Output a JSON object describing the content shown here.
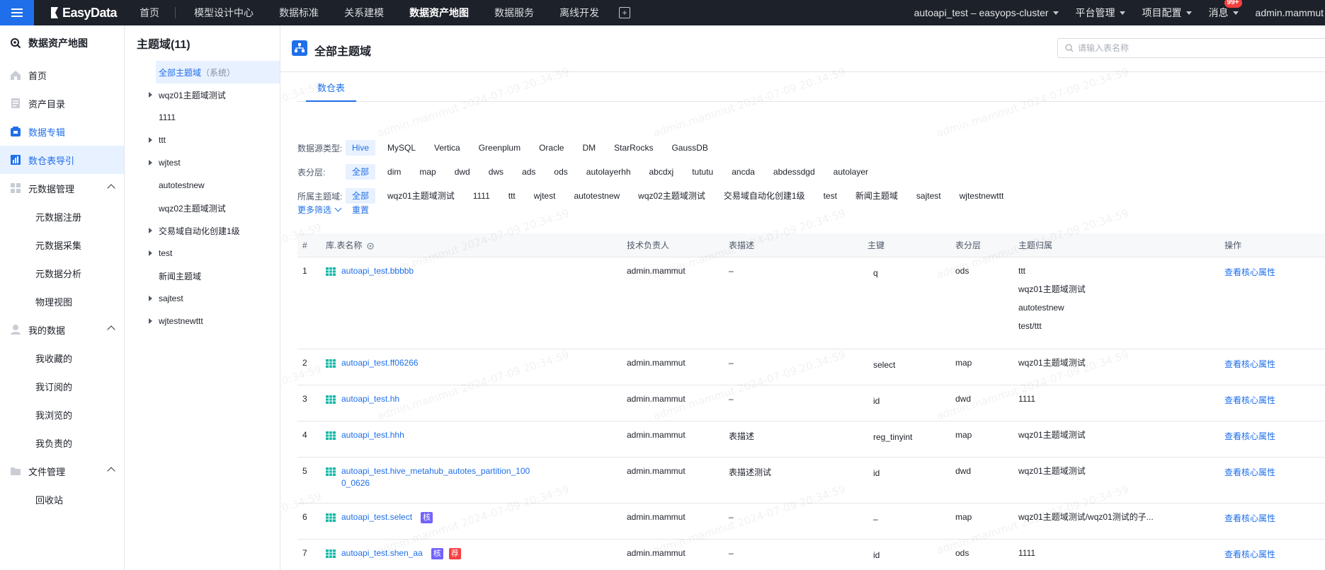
{
  "topnav": {
    "brand": "EasyData",
    "items": [
      "首页",
      "模型设计中心",
      "数据标准",
      "关系建模",
      "数据资产地图",
      "数据服务",
      "离线开发"
    ],
    "active": "数据资产地图",
    "cluster": "autoapi_test – easyops-cluster",
    "platform": "平台管理",
    "project": "项目配置",
    "messages": "消息",
    "message_badge": "99+",
    "user": "admin.mammut"
  },
  "sidebar": {
    "title": "数据资产地图",
    "home": "首页",
    "catalog": "资产目录",
    "album": "数据专辑",
    "guide": "数仓表导引",
    "meta": "元数据管理",
    "meta_sub": [
      "元数据注册",
      "元数据采集",
      "元数据分析",
      "物理视图"
    ],
    "mydata": "我的数据",
    "mydata_sub": [
      "我收藏的",
      "我订阅的",
      "我浏览的",
      "我负责的"
    ],
    "files": "文件管理",
    "files_sub": [
      "回收站"
    ]
  },
  "tree": {
    "title": "主题域(11)",
    "selected_label": "全部主题域",
    "selected_suffix": "（系统）",
    "nodes": [
      {
        "label": "wqz01主题域测试",
        "expandable": true
      },
      {
        "label": "1111",
        "expandable": false
      },
      {
        "label": "ttt",
        "expandable": true
      },
      {
        "label": "wjtest",
        "expandable": true
      },
      {
        "label": "autotestnew",
        "expandable": false
      },
      {
        "label": "wqz02主题域测试",
        "expandable": false
      },
      {
        "label": "交易域自动化创建1级",
        "expandable": true
      },
      {
        "label": "test",
        "expandable": true
      },
      {
        "label": "新闻主题域",
        "expandable": false
      },
      {
        "label": "sajtest",
        "expandable": true
      },
      {
        "label": "wjtestnewttt",
        "expandable": true
      }
    ]
  },
  "main": {
    "title": "全部主题域",
    "search_placeholder": "请输入表名称",
    "tab": "数仓表",
    "filters": {
      "source_label": "数据源类型:",
      "source_options": [
        "Hive",
        "MySQL",
        "Vertica",
        "Greenplum",
        "Oracle",
        "DM",
        "StarRocks",
        "GaussDB"
      ],
      "layer_label": "表分层:",
      "layer_options": [
        "全部",
        "dim",
        "map",
        "dwd",
        "dws",
        "ads",
        "ods",
        "autolayerhh",
        "abcdxj",
        "tututu",
        "ancda",
        "abdessdgd",
        "autolayer"
      ],
      "domain_label": "所属主题域:",
      "domain_options": [
        "全部",
        "wqz01主题域测试",
        "1111",
        "ttt",
        "wjtest",
        "autotestnew",
        "wqz02主题域测试",
        "交易域自动化创建1级",
        "test",
        "新闻主题域",
        "sajtest",
        "wjtestnewttt"
      ]
    },
    "more_filter": "更多筛选",
    "reset": "重置"
  },
  "table": {
    "headers": [
      "#",
      "库.表名称",
      "技术负责人",
      "表描述",
      "主键",
      "表分层",
      "主题归属",
      "操作"
    ],
    "rows": [
      {
        "no": "1",
        "name": "autoapi_test.bbbbb",
        "owner": "admin.mammut",
        "desc": "–",
        "pk": "q",
        "layer": "ods",
        "domains": [
          "ttt",
          "wqz01主题域测试",
          "autotestnew",
          "test/ttt"
        ],
        "action": "查看核心属性",
        "tags": []
      },
      {
        "no": "2",
        "name": "autoapi_test.ff06266",
        "owner": "admin.mammut",
        "desc": "–",
        "pk": "select",
        "layer": "map",
        "domains": [
          "wqz01主题域测试"
        ],
        "action": "查看核心属性",
        "tags": []
      },
      {
        "no": "3",
        "name": "autoapi_test.hh",
        "owner": "admin.mammut",
        "desc": "–",
        "pk": "id",
        "layer": "dwd",
        "domains": [
          "1111"
        ],
        "action": "查看核心属性",
        "tags": []
      },
      {
        "no": "4",
        "name": "autoapi_test.hhh",
        "owner": "admin.mammut",
        "desc": "表描述",
        "pk": "reg_tinyint",
        "layer": "map",
        "domains": [
          "wqz01主题域测试"
        ],
        "action": "查看核心属性",
        "tags": []
      },
      {
        "no": "5",
        "name": "autoapi_test.hive_metahub_autotes_partition_100",
        "name2": "0_0626",
        "owner": "admin.mammut",
        "desc": "表描述测试",
        "pk": "id",
        "layer": "dwd",
        "domains": [
          "wqz01主题域测试"
        ],
        "action": "查看核心属性",
        "tags": []
      },
      {
        "no": "6",
        "name": "autoapi_test.select",
        "owner": "admin.mammut",
        "desc": "–",
        "pk": "–",
        "layer": "map",
        "domains": [
          "wqz01主题域测试/wqz01测试的子..."
        ],
        "action": "查看核心属性",
        "tags": [
          "核"
        ]
      },
      {
        "no": "7",
        "name": "autoapi_test.shen_aa",
        "owner": "admin.mammut",
        "desc": "–",
        "pk": "id",
        "layer": "ods",
        "domains": [
          "1111"
        ],
        "action": "查看核心属性",
        "tags": [
          "核",
          "荐"
        ]
      }
    ]
  },
  "watermark": "admin.mammut 2024-07-09 20:34:59",
  "colors": {
    "accent": "#1f6feb",
    "nav_bg": "#1d2129",
    "tag_core": "#7262fd",
    "tag_rec": "#f53f3f",
    "table_icon": "#14b8a6"
  }
}
